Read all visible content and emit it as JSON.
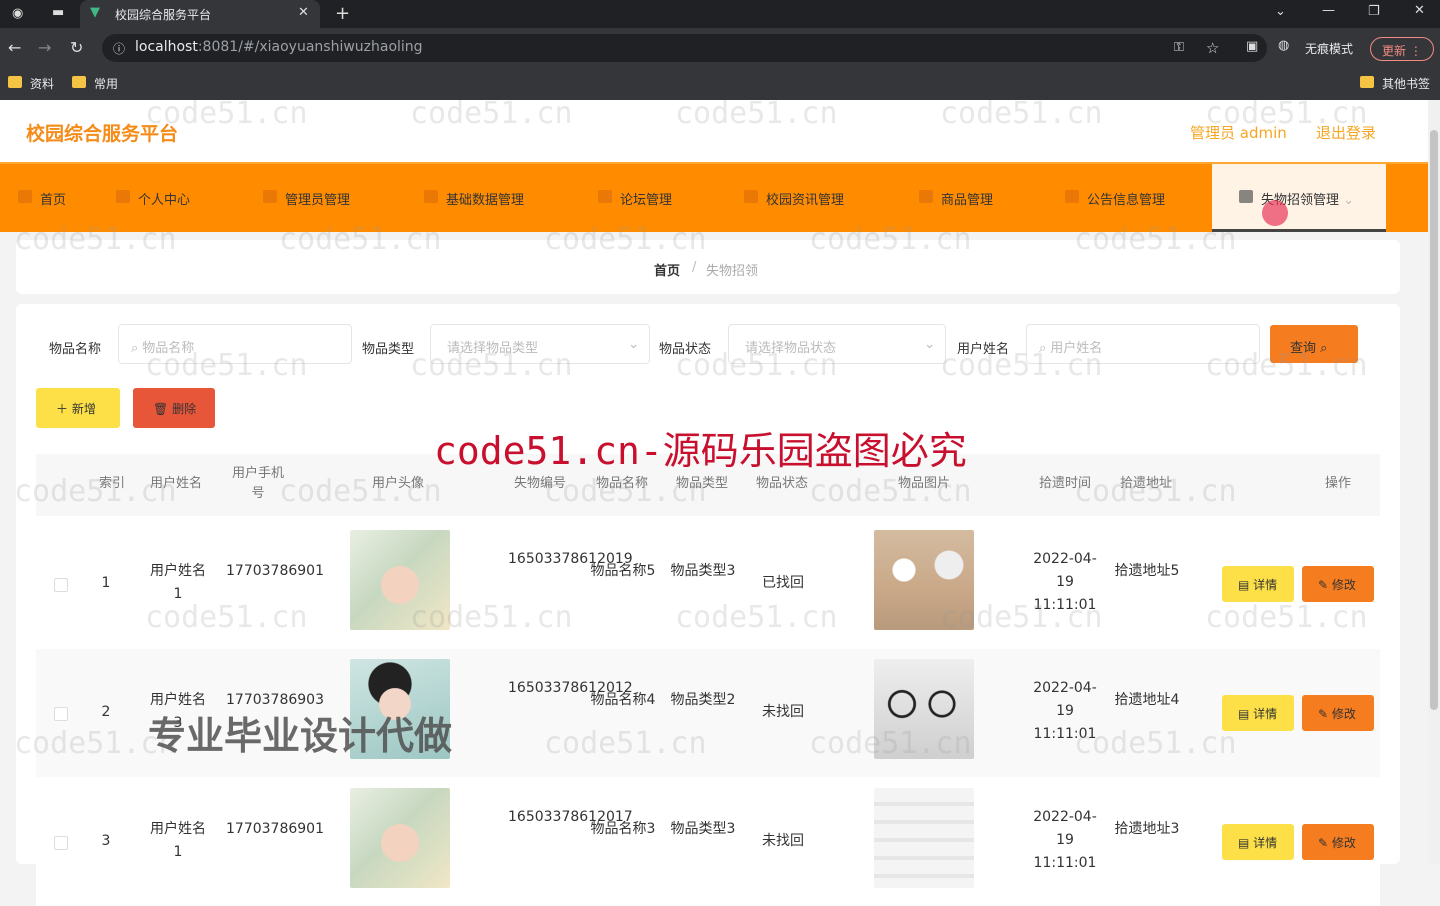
{
  "browser": {
    "tab_title": "校园综合服务平台",
    "url_host": "localhost",
    "url_path": ":8081/#/xiaoyuanshiwuzhaoling",
    "incognito_label": "无痕模式",
    "update_label": "更新",
    "bookmarks": [
      "资料",
      "常用"
    ],
    "other_bookmarks": "其他书签"
  },
  "header": {
    "logo": "校园综合服务平台",
    "user": "管理员 admin",
    "logout": "退出登录"
  },
  "nav": {
    "items": [
      "首页",
      "个人中心",
      "管理员管理",
      "基础数据管理",
      "论坛管理",
      "校园资讯管理",
      "商品管理",
      "公告信息管理",
      "失物招领管理"
    ]
  },
  "breadcrumb": {
    "home": "首页",
    "sep": "/",
    "current": "失物招领"
  },
  "filters": {
    "name_label": "物品名称",
    "name_placeholder": "物品名称",
    "type_label": "物品类型",
    "type_placeholder": "请选择物品类型",
    "status_label": "物品状态",
    "status_placeholder": "请选择物品状态",
    "user_label": "用户姓名",
    "user_placeholder": "用户姓名",
    "query": "查询"
  },
  "actions": {
    "add": "新增",
    "delete": "删除"
  },
  "table": {
    "headers": [
      "索引",
      "用户姓名",
      "用户手机号",
      "用户头像",
      "失物编号",
      "物品名称",
      "物品类型",
      "物品状态",
      "物品图片",
      "拾遗时间",
      "拾遗地址",
      "操作"
    ],
    "detail_label": "详情",
    "edit_label": "修改",
    "rows": [
      {
        "index": "1",
        "user": "用户姓名1",
        "phone": "17703786901",
        "code": "16503378612019",
        "name": "物品名称5",
        "type": "物品类型3",
        "status": "已找回",
        "time": "2022-04-19 11:11:01",
        "addr": "拾遗地址5"
      },
      {
        "index": "2",
        "user": "用户姓名3",
        "phone": "17703786903",
        "code": "16503378612012",
        "name": "物品名称4",
        "type": "物品类型2",
        "status": "未找回",
        "time": "2022-04-19 11:11:01",
        "addr": "拾遗地址4"
      },
      {
        "index": "3",
        "user": "用户姓名1",
        "phone": "17703786901",
        "code": "16503378612017",
        "name": "物品名称3",
        "type": "物品类型3",
        "status": "未找回",
        "time": "2022-04-19 11:11:01",
        "addr": "拾遗地址3"
      }
    ]
  },
  "watermarks": {
    "site": "code51.cn",
    "red": "code51.cn-源码乐园盗图必究",
    "gray": "专业毕业设计代做"
  }
}
